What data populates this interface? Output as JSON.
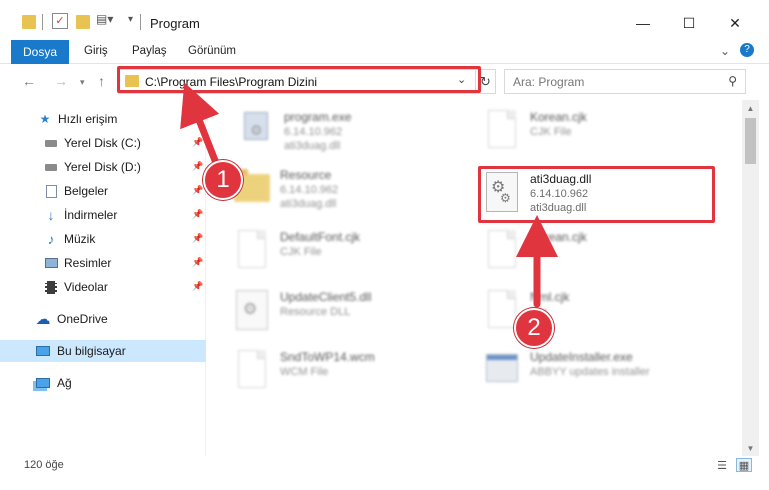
{
  "window": {
    "title": "Program",
    "minimize_icon": "minimize-icon",
    "maximize_icon": "maximize-icon",
    "close_icon": "close-icon"
  },
  "ribbon": {
    "tabs": [
      {
        "label": "Dosya"
      },
      {
        "label": "Giriş"
      },
      {
        "label": "Paylaş"
      },
      {
        "label": "Görünüm"
      }
    ]
  },
  "navbar": {
    "address_path": "C:\\Program Files\\Program Dizini",
    "search_placeholder": "Ara: Program"
  },
  "sidebar": {
    "items": [
      {
        "label": "Hızlı erişim",
        "icon": "star-icon"
      },
      {
        "label": "Yerel Disk (C:)",
        "icon": "drive-icon",
        "pinned": true
      },
      {
        "label": "Yerel Disk (D:)",
        "icon": "drive-icon",
        "pinned": true
      },
      {
        "label": "Belgeler",
        "icon": "documents-icon",
        "pinned": true
      },
      {
        "label": "İndirmeler",
        "icon": "download-icon",
        "pinned": true
      },
      {
        "label": "Müzik",
        "icon": "music-icon",
        "pinned": true
      },
      {
        "label": "Resimler",
        "icon": "pictures-icon",
        "pinned": true
      },
      {
        "label": "Videolar",
        "icon": "videos-icon",
        "pinned": true
      },
      {
        "label": "OneDrive",
        "icon": "cloud-icon"
      },
      {
        "label": "Bu bilgisayar",
        "icon": "computer-icon",
        "selected": true
      },
      {
        "label": "Ağ",
        "icon": "network-icon"
      }
    ]
  },
  "files": [
    {
      "name": "program.exe",
      "line2": "6.14.10.962",
      "line3": "ati3duag.dll",
      "icon": "exe-icon"
    },
    {
      "name": "Korean.cjk",
      "line2": "CJK File",
      "line3": "",
      "icon": "file-icon"
    },
    {
      "name": "Resource",
      "line2": "6.14.10.962",
      "line3": "ati3duag.dll",
      "icon": "folder-icon"
    },
    {
      "name": "ati3duag.dll",
      "line2": "6.14.10.962",
      "line3": "ati3duag.dll",
      "icon": "dll-icon"
    },
    {
      "name": "DefaultFont.cjk",
      "line2": "CJK File",
      "line3": "",
      "icon": "file-icon"
    },
    {
      "name": "Korean.cjk",
      "line2": "",
      "line3": "",
      "icon": "file-icon"
    },
    {
      "name": "UpdateClient5.dll",
      "line2": "Resource DLL",
      "line3": "",
      "icon": "dll-icon"
    },
    {
      "name": "Nml.cjk",
      "line2": "File",
      "line3": "",
      "icon": "file-icon"
    },
    {
      "name": "SndToWP14.wcm",
      "line2": "WCM File",
      "line3": "",
      "icon": "file-icon"
    },
    {
      "name": "UpdateInstaller.exe",
      "line2": "ABBYY updates installer",
      "line3": "",
      "icon": "exe-icon"
    }
  ],
  "status": {
    "item_count": "120 öğe"
  },
  "annotations": {
    "step1": "1",
    "step2": "2",
    "highlight_color": "#e0353f"
  },
  "colors": {
    "accent": "#1979ca",
    "selection": "#cce8ff"
  }
}
